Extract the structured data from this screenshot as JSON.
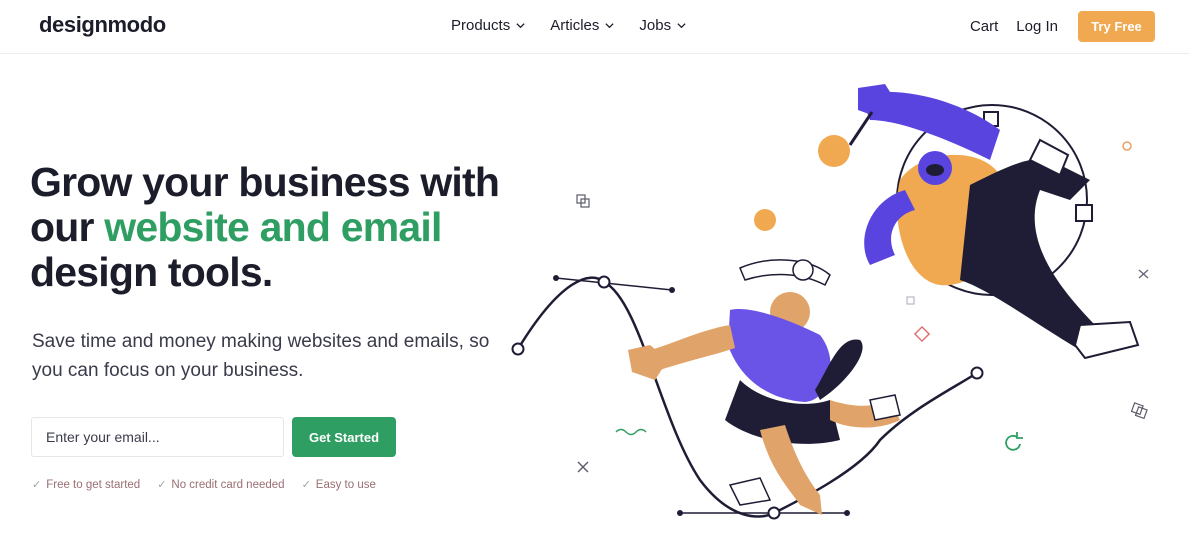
{
  "header": {
    "logo": "designmodo",
    "nav": [
      {
        "label": "Products"
      },
      {
        "label": "Articles"
      },
      {
        "label": "Jobs"
      }
    ],
    "cart_label": "Cart",
    "login_label": "Log In",
    "try_label": "Try Free"
  },
  "hero": {
    "headline_part1": "Grow your business with our ",
    "headline_accent": "website and email",
    "headline_part2": " design tools.",
    "subtitle": "Save time and money making websites and emails, so you can focus on your business.",
    "email_placeholder": "Enter your email...",
    "cta_label": "Get Started",
    "checks": [
      {
        "icon": "check-icon",
        "label": "Free to get started"
      },
      {
        "icon": "check-icon",
        "label": "No credit card needed"
      },
      {
        "icon": "check-icon",
        "label": "Easy to use"
      }
    ]
  },
  "colors": {
    "accent_green": "#2f9e62",
    "accent_orange": "#f1a951",
    "illustration_purple": "#5a44e0",
    "illustration_navy": "#1f1d35"
  }
}
